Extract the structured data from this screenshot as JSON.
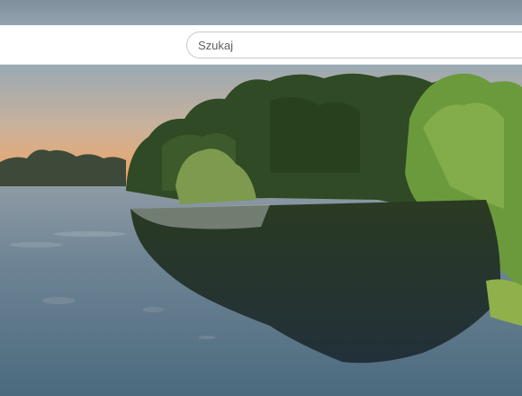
{
  "search": {
    "placeholder": "Szukaj"
  },
  "video": {
    "scene_icon": "landscape-photo"
  },
  "colors": {
    "sky_top": "#9fb1bf",
    "sky_glow": "#e8a86e",
    "water": "#536f82",
    "foliage": "#2e4a22"
  }
}
